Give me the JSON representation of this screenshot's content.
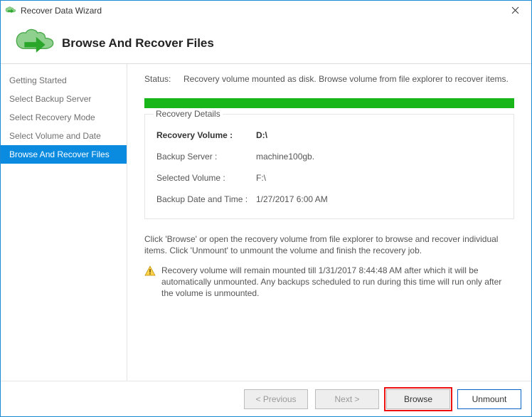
{
  "window": {
    "title": "Recover Data Wizard"
  },
  "header": {
    "title": "Browse And Recover Files"
  },
  "sidebar": {
    "items": [
      {
        "label": "Getting Started"
      },
      {
        "label": "Select Backup Server"
      },
      {
        "label": "Select Recovery Mode"
      },
      {
        "label": "Select Volume and Date"
      },
      {
        "label": "Browse And Recover Files"
      }
    ]
  },
  "status": {
    "label": "Status:",
    "text": "Recovery volume mounted as disk. Browse volume from file explorer to recover items."
  },
  "details": {
    "legend": "Recovery Details",
    "rows": [
      {
        "k": "Recovery Volume :",
        "v": "D:\\"
      },
      {
        "k": "Backup Server :",
        "v": "machine100gb."
      },
      {
        "k": "Selected Volume :",
        "v": "F:\\"
      },
      {
        "k": "Backup Date and Time :",
        "v": "1/27/2017 6:00 AM"
      }
    ]
  },
  "instructions": "Click 'Browse' or open the recovery volume from file explorer to browse and recover individual items. Click 'Unmount' to unmount the volume and finish the recovery job.",
  "warning": "Recovery volume will remain mounted till 1/31/2017 8:44:48 AM after which it will be automatically unmounted. Any backups scheduled to run during this time will run only after the volume is unmounted.",
  "footer": {
    "previous": "< Previous",
    "next": "Next >",
    "browse": "Browse",
    "unmount": "Unmount"
  }
}
